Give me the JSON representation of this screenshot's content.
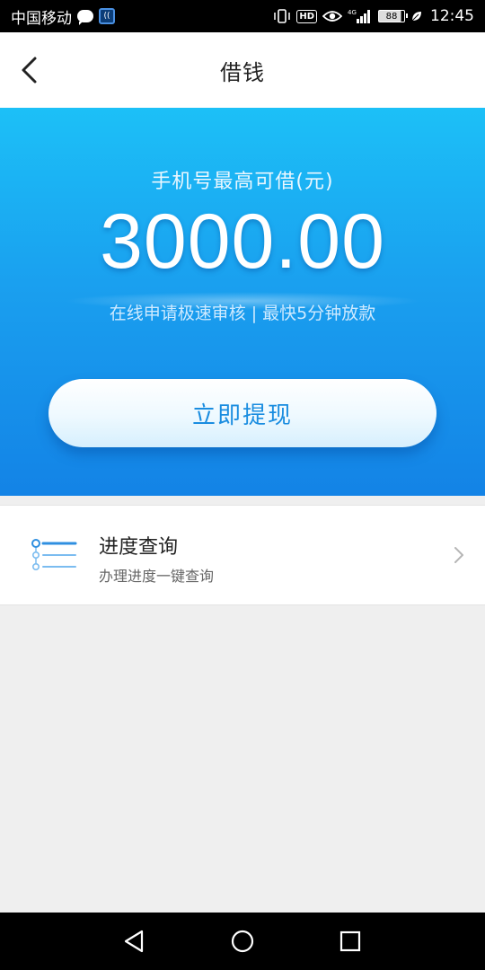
{
  "status_bar": {
    "carrier": "中国移动",
    "battery": "88",
    "time": "12:45",
    "network": "4G"
  },
  "header": {
    "title": "借钱"
  },
  "hero": {
    "subtitle": "手机号最高可借(元)",
    "amount": "3000.00",
    "tagline": "在线申请极速审核 | 最快5分钟放款",
    "button_label": "立即提现",
    "colors": {
      "gradient_top": "#1cc0f7",
      "gradient_bottom": "#1383e6",
      "button_text": "#1a8de0"
    }
  },
  "progress": {
    "title": "进度查询",
    "description": "办理进度一键查询",
    "icon": "list-progress-icon"
  },
  "nav_bar": {
    "buttons": [
      "back-triangle-icon",
      "home-circle-icon",
      "recent-square-icon"
    ]
  }
}
